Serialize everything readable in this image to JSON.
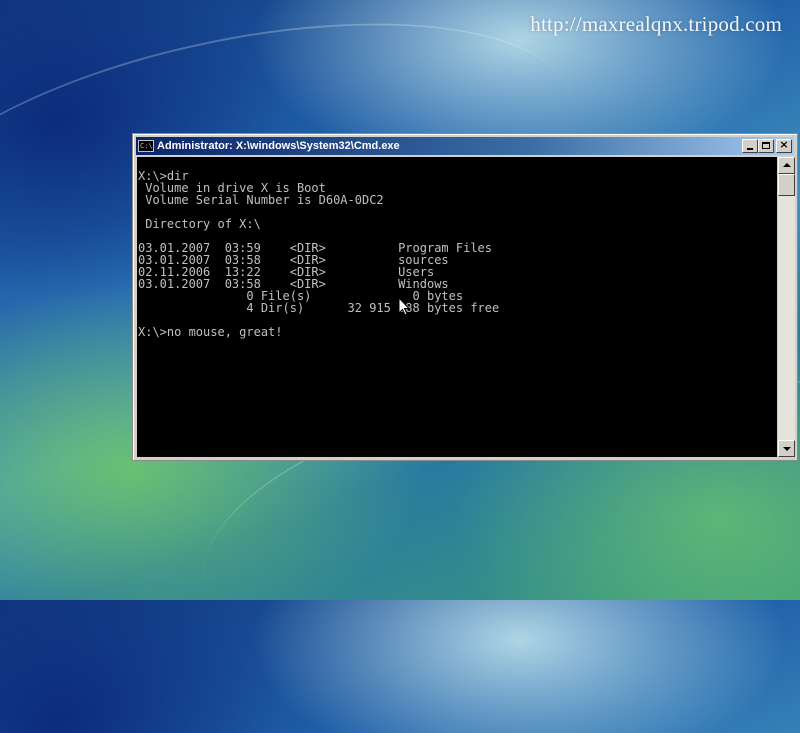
{
  "watermark": "http://maxrealqnx.tripod.com",
  "window": {
    "title": "Administrator: X:\\windows\\System32\\Cmd.exe",
    "icon": "cmd-icon",
    "icon_text": "C:\\"
  },
  "console": {
    "lines": [
      "X:\\>dir",
      " Volume in drive X is Boot",
      " Volume Serial Number is D60A-0DC2",
      "",
      " Directory of X:\\",
      "",
      "03.01.2007  03:59    <DIR>          Program Files",
      "03.01.2007  03:58    <DIR>          sources",
      "02.11.2006  13:22    <DIR>          Users",
      "03.01.2007  03:58    <DIR>          Windows",
      "               0 File(s)              0 bytes",
      "               4 Dir(s)      32 915 088 bytes free",
      "",
      "X:\\>no mouse, great!"
    ],
    "text_color": "#c0c0c0",
    "background_color": "#000000"
  }
}
